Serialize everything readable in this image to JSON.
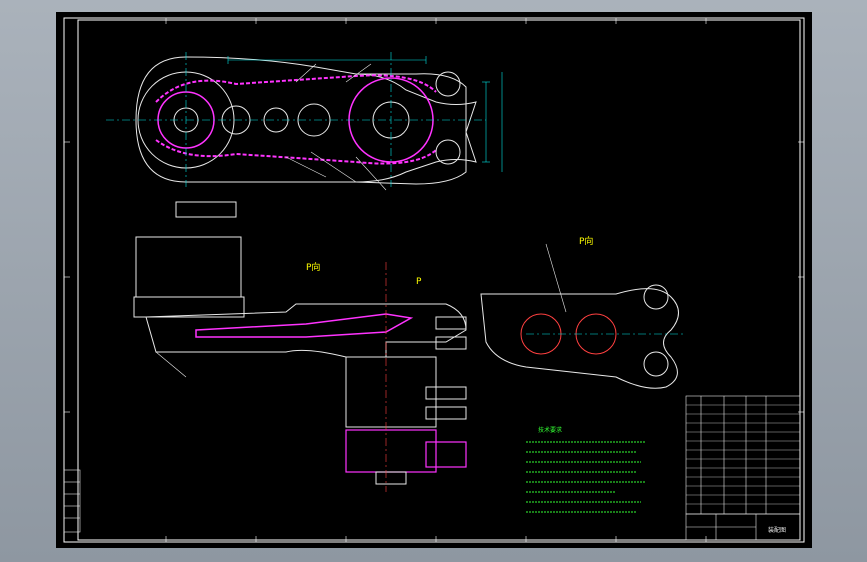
{
  "colors": {
    "frame": "#ffffff",
    "dimension": "#00e5e5",
    "chain": "#ff33ff",
    "body": "#e8e8e8",
    "callout": "#ffff00",
    "notes": "#33ff33",
    "detail": "#ff4040"
  },
  "views": {
    "main_label": "P向",
    "side_label": "P",
    "right_view_label": "P向"
  },
  "notes": {
    "title": "技术要求"
  },
  "title_block": {
    "right_label": "装配图"
  }
}
